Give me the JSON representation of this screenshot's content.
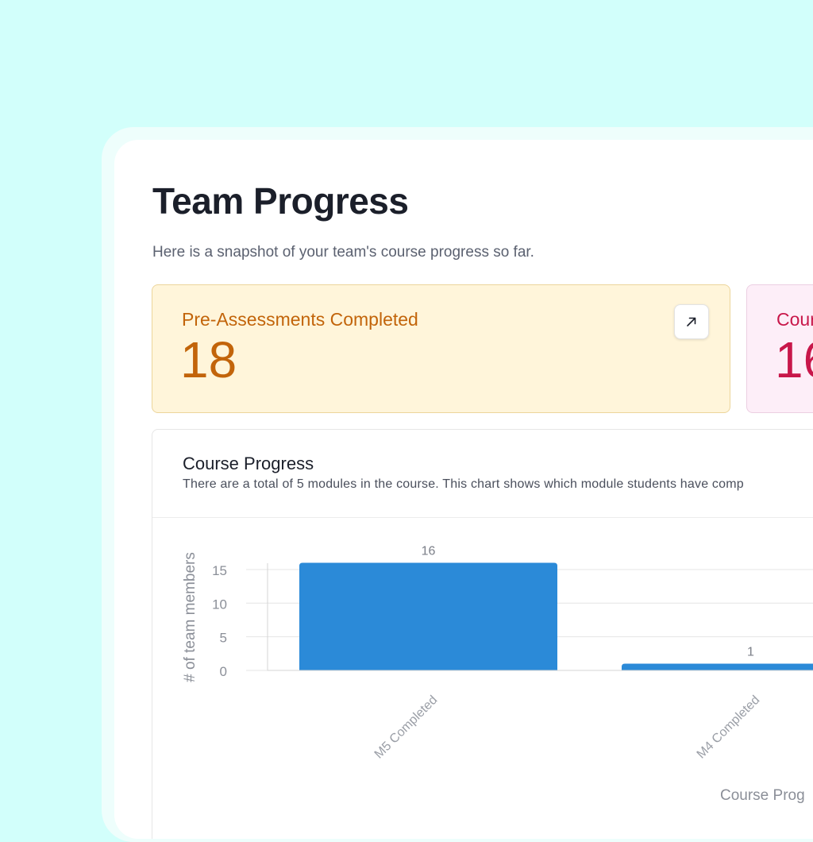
{
  "page": {
    "title": "Team Progress",
    "subtitle": "Here is a snapshot of your team's course progress so far."
  },
  "stats": [
    {
      "label": "Pre-Assessments Completed",
      "value": "18",
      "color": "#c2640a"
    },
    {
      "label": "Cour",
      "value": "16",
      "color": "#c8174a"
    }
  ],
  "expand_icon": "arrow-up-right-icon",
  "chart": {
    "title": "Course Progress",
    "description": "There are a total of 5 modules in the course. This chart shows which module students have comp"
  },
  "chart_data": {
    "type": "bar",
    "categories": [
      "M5 Completed",
      "M4 Completed"
    ],
    "values": [
      16,
      1
    ],
    "data_labels": [
      "16",
      "1"
    ],
    "ylabel": "# of team members",
    "xlabel": "Course Prog",
    "ylim": [
      0,
      16
    ],
    "yticks": [
      0,
      5,
      10,
      15
    ],
    "ytick_labels": [
      "0",
      "5",
      "10",
      "15"
    ],
    "grid": true,
    "bar_color": "#2b8ad8"
  }
}
